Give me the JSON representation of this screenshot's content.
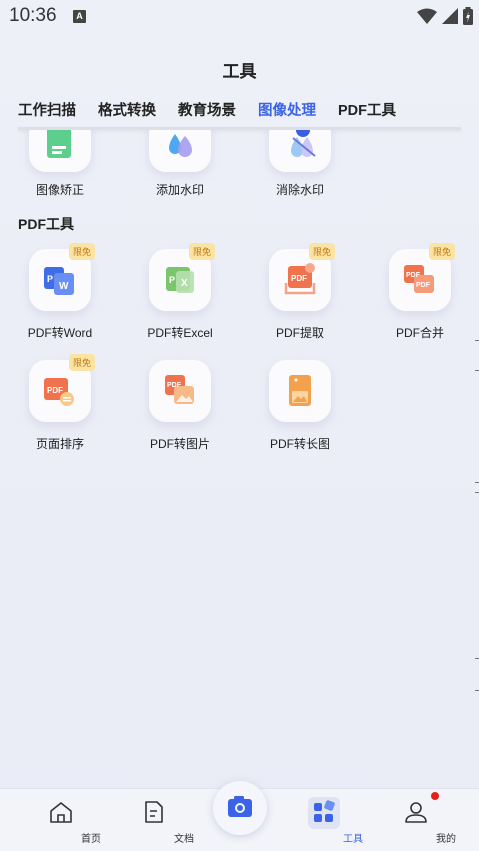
{
  "status_bar": {
    "time": "10:36",
    "notification_icon": "A"
  },
  "header": {
    "title": "工具"
  },
  "tabs": [
    {
      "label": "工作扫描",
      "active": false
    },
    {
      "label": "格式转换",
      "active": false
    },
    {
      "label": "教育场景",
      "active": false
    },
    {
      "label": "图像处理",
      "active": true
    },
    {
      "label": "PDF工具",
      "active": false
    }
  ],
  "image_tools": [
    {
      "label": "图像矫正",
      "icon": "image-correct-icon"
    },
    {
      "label": "添加水印",
      "icon": "add-watermark-icon"
    },
    {
      "label": "消除水印",
      "icon": "remove-watermark-icon"
    }
  ],
  "pdf_section": {
    "title": "PDF工具",
    "items": [
      {
        "label": "PDF转Word",
        "badge": "限免",
        "icon": "pdf-to-word-icon"
      },
      {
        "label": "PDF转Excel",
        "badge": "限免",
        "icon": "pdf-to-excel-icon"
      },
      {
        "label": "PDF提取",
        "badge": "限免",
        "icon": "pdf-extract-icon"
      },
      {
        "label": "PDF合并",
        "badge": "限免",
        "icon": "pdf-merge-icon"
      },
      {
        "label": "页面排序",
        "badge": "限免",
        "icon": "page-sort-icon"
      },
      {
        "label": "PDF转图片",
        "badge": "",
        "icon": "pdf-to-image-icon"
      },
      {
        "label": "PDF转长图",
        "badge": "",
        "icon": "pdf-to-long-image-icon"
      }
    ]
  },
  "bottom_nav": [
    {
      "label": "首页",
      "icon": "home-icon",
      "active": false
    },
    {
      "label": "文档",
      "icon": "document-icon",
      "active": false
    },
    {
      "label": "",
      "icon": "camera-icon",
      "active": false
    },
    {
      "label": "工具",
      "icon": "tools-icon",
      "active": true
    },
    {
      "label": "我的",
      "icon": "profile-icon",
      "active": false
    }
  ],
  "colors": {
    "accent": "#3b63e8",
    "badge_bg": "#fbe3a4",
    "badge_text": "#c37812",
    "notification_dot": "#e5201a"
  }
}
